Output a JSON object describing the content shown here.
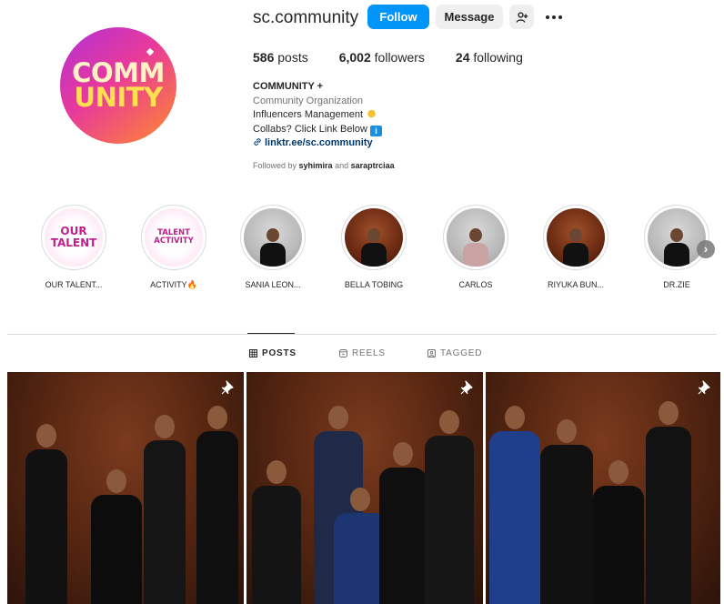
{
  "profile": {
    "username": "sc.community",
    "follow_label": "Follow",
    "message_label": "Message",
    "avatar_text_line1": "COMM",
    "avatar_text_line2": "UNITY"
  },
  "stats": {
    "posts_count": "586",
    "posts_label": "posts",
    "followers_count": "6,002",
    "followers_label": "followers",
    "following_count": "24",
    "following_label": "following"
  },
  "bio": {
    "name": "COMMUNITY +",
    "category": "Community Organization",
    "line1": "Influencers Management",
    "line2": "Collabs? Click Link Below",
    "link": "linktr.ee/sc.community",
    "followed_by_prefix": "Followed by",
    "followed_by_user1": "syhimira",
    "followed_by_and": "and",
    "followed_by_user2": "saraptrciaa"
  },
  "highlights": [
    {
      "label": "OUR TALENT...",
      "cover_text": "OUR TALENT",
      "style": "pinkcard"
    },
    {
      "label": "ACTIVITY🔥",
      "cover_text": "TALENT ACTIVITY",
      "style": "pinkcard"
    },
    {
      "label": "SANIA LEON...",
      "style": "photo-light"
    },
    {
      "label": "BELLA TOBING",
      "style": "photo-brown"
    },
    {
      "label": "CARLOS",
      "style": "photo-light"
    },
    {
      "label": "RIYUKA BUN...",
      "style": "photo-brown"
    },
    {
      "label": "DR.ZIE",
      "style": "photo-light"
    }
  ],
  "tabs": {
    "posts": "POSTS",
    "reels": "REELS",
    "tagged": "TAGGED"
  },
  "colors": {
    "primary_button": "#0095f6",
    "secondary_button": "#efefef",
    "link": "#00376b"
  }
}
